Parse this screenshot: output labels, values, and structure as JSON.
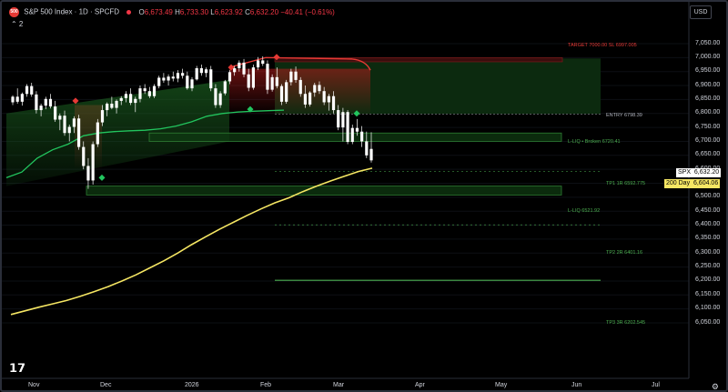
{
  "header": {
    "symbol_badge": "500",
    "title": "S&P 500 Index · 1D · SPCFD",
    "ohlc": {
      "o_label": "O",
      "o": "6,673.49",
      "h_label": "H",
      "h": "6,733.30",
      "l_label": "L",
      "l": "6,623.92",
      "c_label": "C",
      "c": "6,632.20",
      "change": "−40.41 (−0.61%)"
    },
    "indicator_toggle": "⌃ 2",
    "currency": "USD"
  },
  "price_axis": {
    "ticks": [
      "7,050.00",
      "7,000.00",
      "6,950.00",
      "6,900.00",
      "6,850.00",
      "6,800.00",
      "6,750.00",
      "6,700.00",
      "6,650.00",
      "6,600.00",
      "6,550.00",
      "6,500.00",
      "6,450.00",
      "6,400.00",
      "6,350.00",
      "6,300.00",
      "6,250.00",
      "6,200.00",
      "6,150.00",
      "6,100.00",
      "6,050.00"
    ],
    "spx_tag": {
      "name": "SPX",
      "value": "6,632.20"
    },
    "ma_tag": {
      "name": "200 Day",
      "value": "6,604.06"
    }
  },
  "time_axis": {
    "labels": [
      "Nov",
      "Dec",
      "2026",
      "Feb",
      "Mar",
      "Apr",
      "May",
      "Jun",
      "Jul"
    ]
  },
  "annotations": {
    "sl": "TARGET 7000.00   SL 6997.005",
    "entry": "ENTRY 6798.39",
    "liq_broken": "L-LIQ • Broken 6720.41",
    "tp1": "TP1 1R 6592.775",
    "liq": "L-LIQ 6521.92",
    "tp2": "TP2 2R 6401.16",
    "tp3": "TP3 3R 6202.545"
  },
  "chart_data": {
    "type": "candlestick",
    "ylim": [
      6030,
      7070
    ],
    "y_ticks": [
      7050,
      7000,
      6950,
      6900,
      6850,
      6800,
      6750,
      6700,
      6650,
      6600,
      6550,
      6500,
      6450,
      6400,
      6350,
      6300,
      6250,
      6200,
      6150,
      6100,
      6050
    ],
    "x_labels": [
      "Nov",
      "Dec",
      "2026",
      "Feb",
      "Mar",
      "Apr",
      "May",
      "Jun",
      "Jul"
    ],
    "candles": [
      [
        6840,
        6865,
        6830,
        6860
      ],
      [
        6860,
        6890,
        6835,
        6842
      ],
      [
        6842,
        6875,
        6828,
        6870
      ],
      [
        6870,
        6905,
        6860,
        6898
      ],
      [
        6898,
        6910,
        6860,
        6868
      ],
      [
        6868,
        6880,
        6800,
        6812
      ],
      [
        6812,
        6835,
        6790,
        6828
      ],
      [
        6828,
        6860,
        6815,
        6852
      ],
      [
        6852,
        6870,
        6818,
        6825
      ],
      [
        6825,
        6845,
        6770,
        6778
      ],
      [
        6778,
        6800,
        6740,
        6792
      ],
      [
        6792,
        6810,
        6720,
        6730
      ],
      [
        6730,
        6760,
        6700,
        6752
      ],
      [
        6752,
        6790,
        6730,
        6782
      ],
      [
        6782,
        6795,
        6670,
        6680
      ],
      [
        6680,
        6700,
        6600,
        6612
      ],
      [
        6612,
        6640,
        6530,
        6560
      ],
      [
        6560,
        6700,
        6545,
        6690
      ],
      [
        6690,
        6780,
        6680,
        6768
      ],
      [
        6768,
        6830,
        6755,
        6812
      ],
      [
        6812,
        6840,
        6790,
        6835
      ],
      [
        6835,
        6860,
        6815,
        6820
      ],
      [
        6820,
        6850,
        6800,
        6845
      ],
      [
        6845,
        6862,
        6830,
        6855
      ],
      [
        6855,
        6880,
        6840,
        6870
      ],
      [
        6870,
        6890,
        6830,
        6838
      ],
      [
        6838,
        6860,
        6805,
        6852
      ],
      [
        6852,
        6900,
        6840,
        6890
      ],
      [
        6890,
        6905,
        6870,
        6880
      ],
      [
        6880,
        6895,
        6855,
        6862
      ],
      [
        6862,
        6905,
        6855,
        6898
      ],
      [
        6898,
        6935,
        6890,
        6928
      ],
      [
        6928,
        6945,
        6910,
        6918
      ],
      [
        6918,
        6940,
        6900,
        6932
      ],
      [
        6932,
        6950,
        6915,
        6925
      ],
      [
        6925,
        6955,
        6912,
        6945
      ],
      [
        6945,
        6960,
        6925,
        6935
      ],
      [
        6935,
        6950,
        6885,
        6890
      ],
      [
        6890,
        6930,
        6880,
        6922
      ],
      [
        6922,
        6970,
        6918,
        6962
      ],
      [
        6962,
        6975,
        6935,
        6945
      ],
      [
        6945,
        6965,
        6930,
        6958
      ],
      [
        6958,
        6970,
        6880,
        6890
      ],
      [
        6890,
        6905,
        6820,
        6830
      ],
      [
        6830,
        6880,
        6820,
        6872
      ],
      [
        6872,
        6920,
        6865,
        6915
      ],
      [
        6915,
        6955,
        6905,
        6948
      ],
      [
        6948,
        6970,
        6935,
        6962
      ],
      [
        6962,
        6990,
        6950,
        6982
      ],
      [
        6982,
        6995,
        6930,
        6940
      ],
      [
        6940,
        6960,
        6880,
        6892
      ],
      [
        6892,
        6975,
        6885,
        6965
      ],
      [
        6965,
        7002,
        6955,
        6990
      ],
      [
        6990,
        7005,
        6970,
        6978
      ],
      [
        6978,
        6990,
        6870,
        6885
      ],
      [
        6885,
        6940,
        6878,
        6930
      ],
      [
        6930,
        6965,
        6890,
        6898
      ],
      [
        6898,
        6905,
        6830,
        6842
      ],
      [
        6842,
        6920,
        6835,
        6912
      ],
      [
        6912,
        6960,
        6900,
        6950
      ],
      [
        6950,
        6968,
        6910,
        6920
      ],
      [
        6920,
        6930,
        6860,
        6870
      ],
      [
        6870,
        6900,
        6820,
        6832
      ],
      [
        6832,
        6880,
        6825,
        6875
      ],
      [
        6875,
        6910,
        6860,
        6902
      ],
      [
        6902,
        6915,
        6870,
        6880
      ],
      [
        6880,
        6895,
        6830,
        6840
      ],
      [
        6840,
        6870,
        6810,
        6862
      ],
      [
        6862,
        6880,
        6800,
        6812
      ],
      [
        6812,
        6830,
        6740,
        6750
      ],
      [
        6750,
        6820,
        6700,
        6805
      ],
      [
        6805,
        6812,
        6690,
        6698
      ],
      [
        6698,
        6760,
        6690,
        6748
      ],
      [
        6748,
        6780,
        6720,
        6735
      ],
      [
        6735,
        6755,
        6680,
        6700
      ],
      [
        6700,
        6735,
        6640,
        6650
      ],
      [
        6673,
        6733,
        6624,
        6632
      ]
    ],
    "ma200": [
      6080,
      6093,
      6106,
      6118,
      6130,
      6145,
      6162,
      6180,
      6200,
      6222,
      6247,
      6272,
      6300,
      6330,
      6358,
      6385,
      6410,
      6435,
      6458,
      6480,
      6498,
      6520,
      6540,
      6558,
      6575,
      6592,
      6604
    ],
    "trail": [
      6570,
      6590,
      6640,
      6670,
      6690,
      6720,
      6730,
      6735,
      6738,
      6740,
      6745,
      6755,
      6770,
      6790,
      6800,
      6805,
      6808,
      6810,
      6812
    ]
  }
}
